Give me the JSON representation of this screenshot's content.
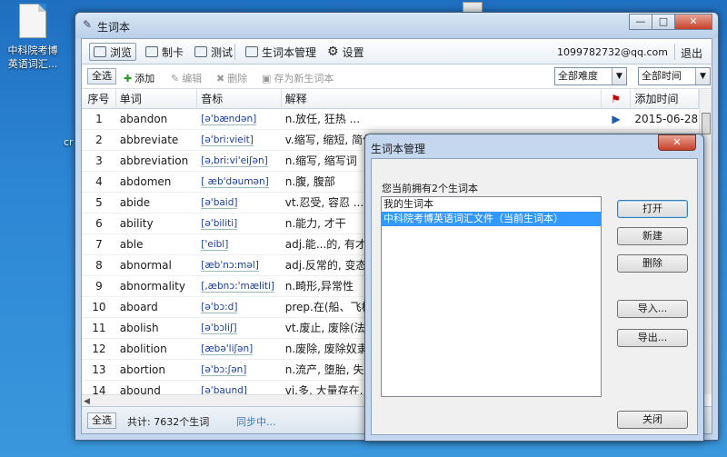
{
  "desktop": {
    "icon_label_line1": "中科院考博",
    "icon_label_line2": "英语词汇...",
    "peek_text": "cr"
  },
  "window": {
    "title": "生词本",
    "buttons": {
      "minimize": "—",
      "maximize": "□",
      "close": "✕"
    }
  },
  "topbar": {
    "browse": "浏览",
    "flashcard": "制卡",
    "test": "测试",
    "manage": "生词本管理",
    "settings": "设置",
    "account": "1099782732@qq.com",
    "exit": "退出"
  },
  "toolbar": {
    "select_all": "全选",
    "add": "添加",
    "edit": "编辑",
    "delete": "删除",
    "save_as": "存为新生词本",
    "difficulty_value": "全部难度",
    "time_value": "全部时间"
  },
  "table": {
    "headers": {
      "no": "序号",
      "word": "单词",
      "phonetic": "音标",
      "definition": "解释",
      "flag": "",
      "date": "添加时间"
    },
    "rows": [
      {
        "no": "1",
        "word": "abandon",
        "phonetic": "[ə'bændən]",
        "definition": "n.放任, 狂热 ...",
        "flag": "▶",
        "date": "2015-06-28"
      },
      {
        "no": "2",
        "word": "abbreviate",
        "phonetic": "[ə'bri:vieit]",
        "definition": "v.缩写, 缩短, 简化",
        "flag": "",
        "date": ""
      },
      {
        "no": "3",
        "word": "abbreviation",
        "phonetic": "[ə,bri:vi'eiʃən]",
        "definition": "n.缩写, 缩写词",
        "flag": "",
        "date": ""
      },
      {
        "no": "4",
        "word": "abdomen",
        "phonetic": "[ æb'dəumən]",
        "definition": "n.腹, 腹部",
        "flag": "",
        "date": ""
      },
      {
        "no": "5",
        "word": "abide",
        "phonetic": "[ə'baid]",
        "definition": "vt.忍受, 容忍 ...",
        "flag": "",
        "date": ""
      },
      {
        "no": "6",
        "word": "ability",
        "phonetic": "[ə'biliti]",
        "definition": "n.能力, 才干",
        "flag": "",
        "date": ""
      },
      {
        "no": "7",
        "word": "able",
        "phonetic": "['eibl]",
        "definition": "adj.能...的, 有才能",
        "flag": "",
        "date": ""
      },
      {
        "no": "8",
        "word": "abnormal",
        "phonetic": "[æb'nɔ:məl]",
        "definition": "adj.反常的, 变态的",
        "flag": "",
        "date": ""
      },
      {
        "no": "9",
        "word": "abnormality",
        "phonetic": "[,æbnɔ:'mæliti]",
        "definition": "n.畸形,异常性",
        "flag": "",
        "date": ""
      },
      {
        "no": "10",
        "word": "aboard",
        "phonetic": "[ə'bɔ:d]",
        "definition": "prep.在(船、飞机",
        "flag": "",
        "date": ""
      },
      {
        "no": "11",
        "word": "abolish",
        "phonetic": "[ə'bɔliʃ]",
        "definition": "vt.废止, 废除(法律",
        "flag": "",
        "date": ""
      },
      {
        "no": "12",
        "word": "abolition",
        "phonetic": "[æbə'liʃən]",
        "definition": "n.废除, 废除奴隶制",
        "flag": "",
        "date": ""
      },
      {
        "no": "13",
        "word": "abortion",
        "phonetic": "[ə'bɔ:ʃən]",
        "definition": "n.流产, 堕胎, 失败",
        "flag": "",
        "date": ""
      },
      {
        "no": "14",
        "word": "abound",
        "phonetic": "[ə'baund]",
        "definition": "vi.多, 大量存在, 富",
        "flag": "",
        "date": ""
      }
    ]
  },
  "footer": {
    "select_all": "全选",
    "stats": "共计:  7632个生词",
    "sync": "同步中..."
  },
  "dialog": {
    "title": "生词本管理",
    "close": "✕",
    "prompt": "您当前拥有2个生词本",
    "items": [
      {
        "label": "我的生词本",
        "selected": false
      },
      {
        "label": "中科院考博英语词汇文件（当前生词本）",
        "selected": true
      }
    ],
    "buttons": {
      "open": "打开",
      "new": "新建",
      "delete": "删除",
      "import": "导入...",
      "export": "导出...",
      "close": "关闭"
    }
  }
}
